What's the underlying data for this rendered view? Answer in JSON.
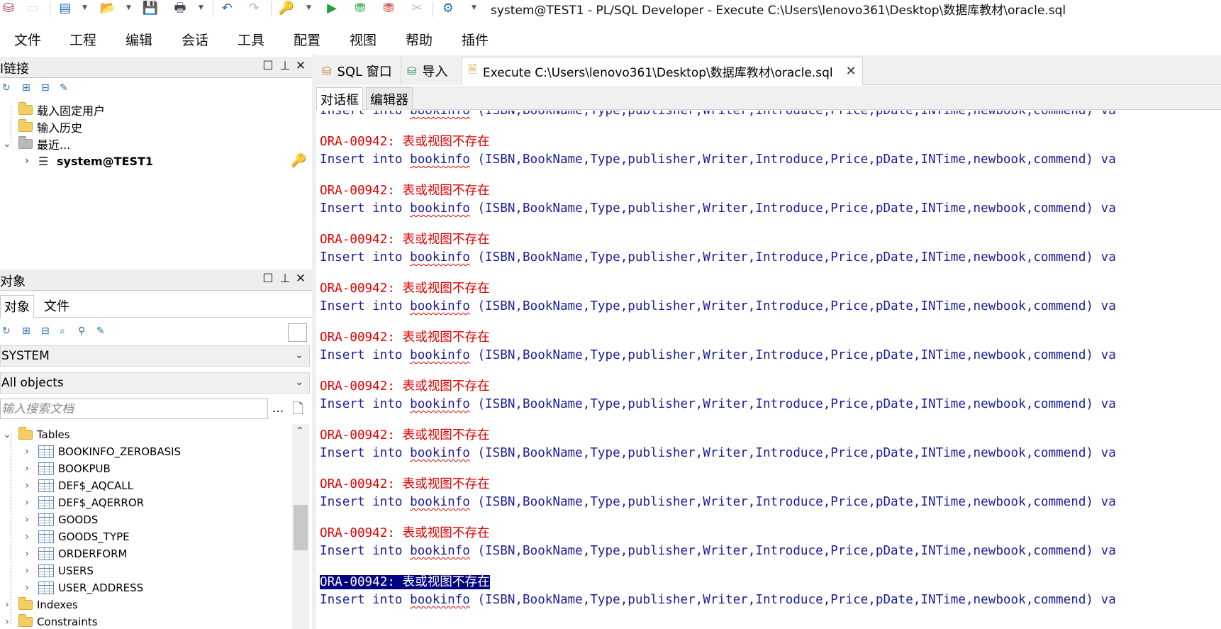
{
  "window_title": "system@TEST1 - PL/SQL Developer - Execute C:\\Users\\lenovo361\\Desktop\\数据库教材\\oracle.sql",
  "menu": [
    "文件",
    "工程",
    "编辑",
    "会话",
    "工具",
    "配置",
    "视图",
    "帮助",
    "插件"
  ],
  "toolbar_icons": [
    "app-icon",
    "blank-icon",
    "new-icon",
    "open-icon",
    "save-icon",
    "print-icon",
    "undo-icon",
    "redo-icon",
    "key-icon",
    "execute-icon",
    "commit-icon",
    "rollback-icon",
    "break-icon",
    "settings-icon"
  ],
  "connections_panel": {
    "title": "l链接",
    "tree": [
      {
        "label": "载入固定用户",
        "type": "folder"
      },
      {
        "label": "输入历史",
        "type": "folder"
      },
      {
        "label": "最近...",
        "type": "folder-grey",
        "expanded": true
      },
      {
        "label": "system@TEST1",
        "type": "db",
        "bold": true
      }
    ]
  },
  "objects_panel": {
    "title": "对象",
    "tabs": [
      "对象",
      "文件"
    ],
    "user_combo": "SYSTEM",
    "filter_combo": "All objects",
    "search_placeholder": "输入搜索文档",
    "more_label": "...",
    "tree": {
      "tables_label": "Tables",
      "tables": [
        "BOOKINFO_ZEROBASIS",
        "BOOKPUB",
        "DEF$_AQCALL",
        "DEF$_AQERROR",
        "GOODS",
        "GOODS_TYPE",
        "ORDERFORM",
        "USERS",
        "USER_ADDRESS"
      ],
      "indexes_label": "Indexes",
      "constraints_label": "Constraints"
    }
  },
  "document_tabs": [
    {
      "label": "SQL 窗口",
      "icon": "sql-window-icon"
    },
    {
      "label": "导入",
      "icon": "import-icon"
    },
    {
      "label": "Execute C:\\Users\\lenovo361\\Desktop\\数据库教材\\oracle.sql",
      "icon": "script-icon",
      "active": true
    }
  ],
  "sub_tabs": [
    "对话框",
    "编辑器"
  ],
  "output": {
    "sql_line": "Insert into bookinfo (ISBN,BookName,Type,publisher,Writer,Introduce,Price,pDate,INTime,newbook,commend) va",
    "error_line": "ORA-00942: 表或视图不存在",
    "repeat_count": 11,
    "selected_error_index": 10
  },
  "colors": {
    "sql_text": "#1c1c9c",
    "error_text": "#e00000",
    "selection_bg": "#000080"
  }
}
